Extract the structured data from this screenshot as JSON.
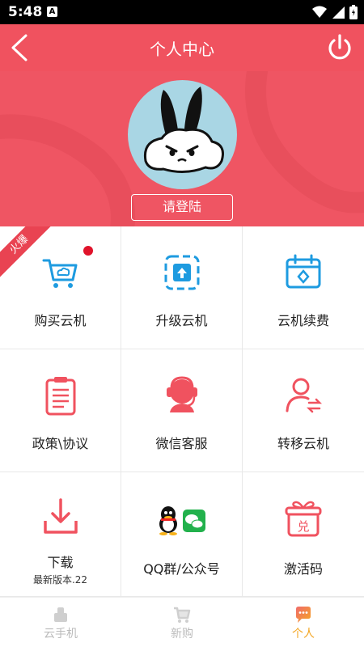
{
  "status_bar": {
    "time": "5:48",
    "notif_letter": "A"
  },
  "header": {
    "title": "个人中心"
  },
  "profile": {
    "login_label": "请登陆"
  },
  "ribbon": {
    "label": "火爆"
  },
  "grid": {
    "items": [
      {
        "label": "购买云机",
        "icon": "cart-icon"
      },
      {
        "label": "升级云机",
        "icon": "upgrade-icon"
      },
      {
        "label": "云机续费",
        "icon": "calendar-icon"
      },
      {
        "label": "政策\\协议",
        "icon": "document-icon"
      },
      {
        "label": "微信客服",
        "icon": "headset-icon"
      },
      {
        "label": "转移云机",
        "icon": "transfer-user-icon"
      },
      {
        "label": "下载",
        "sublabel": "最新版本.22",
        "icon": "download-icon"
      },
      {
        "label": "QQ群/公众号",
        "icon": "qq-wechat-icon"
      },
      {
        "label": "激活码",
        "sublabel_icon_text": "兑",
        "icon": "gift-icon"
      }
    ]
  },
  "tabbar": {
    "tabs": [
      {
        "label": "云手机",
        "icon": "phone-icon",
        "active": false
      },
      {
        "label": "新购",
        "icon": "cart-icon",
        "active": false
      },
      {
        "label": "个人",
        "icon": "chat-icon",
        "active": true
      }
    ]
  },
  "colors": {
    "primary": "#f0525f",
    "icon_blue": "#1e9be0",
    "icon_red": "#f0525f",
    "active_tab": "#f3a623"
  }
}
